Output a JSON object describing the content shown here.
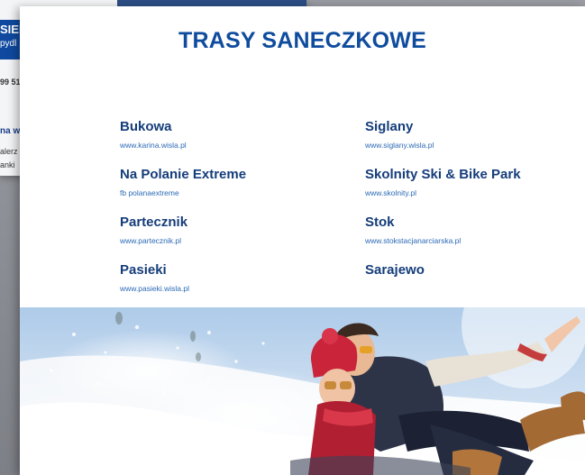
{
  "background_page": {
    "header_title": "SIEK",
    "header_subtitle": "pydl",
    "phone": "99 51",
    "link_fragment": "na w",
    "text_line_1": "alerz",
    "text_line_2": "anki"
  },
  "document": {
    "title": "TRASY SANECZKOWE",
    "tracks_left": [
      {
        "name": "Bukowa",
        "url": "www.karina.wisla.pl"
      },
      {
        "name": "Na Polanie Extreme",
        "url": "fb polanaextreme"
      },
      {
        "name": "Partecznik",
        "url": "www.partecznik.pl"
      },
      {
        "name": "Pasieki",
        "url": "www.pasieki.wisla.pl"
      }
    ],
    "tracks_right": [
      {
        "name": "Siglany",
        "url": "www.siglany.wisla.pl"
      },
      {
        "name": "Skolnity Ski & Bike Park",
        "url": "www.skolnity.pl"
      },
      {
        "name": "Stok",
        "url": "www.stokstacjanarciarska.pl"
      },
      {
        "name": "Sarajewo",
        "url": ""
      }
    ]
  },
  "colors": {
    "title_blue": "#0f4c9e",
    "name_blue": "#153d7a",
    "url_blue": "#2c6ab5"
  }
}
